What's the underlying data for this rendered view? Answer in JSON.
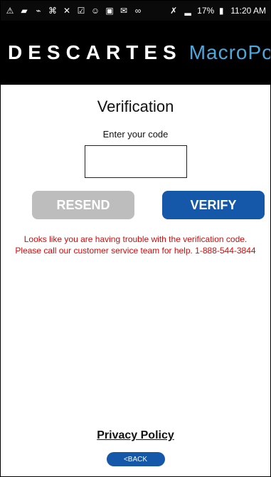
{
  "status_bar": {
    "left_icons": [
      "warning-icon",
      "chat-icon",
      "wifi-icon",
      "hotspot-icon",
      "tools-icon",
      "checklist-icon",
      "emoji-icon",
      "image-icon",
      "mail-icon",
      "voicemail-icon"
    ],
    "mute": "🔇",
    "signal": "📶",
    "battery": "17%",
    "time": "11:20 AM"
  },
  "brand": {
    "descartes": "DESCARTES",
    "macropoint": "MacroPoint"
  },
  "page": {
    "title": "Verification",
    "code_label": "Enter your code",
    "code_value": ""
  },
  "buttons": {
    "resend": "RESEND",
    "verify": "VERIFY"
  },
  "error": {
    "line1": "Looks like you are having trouble with the verification code.",
    "line2": "Please call our customer service team for help.  1-888-544-3844"
  },
  "footer": {
    "privacy": "Privacy Policy",
    "back": "<BACK"
  }
}
